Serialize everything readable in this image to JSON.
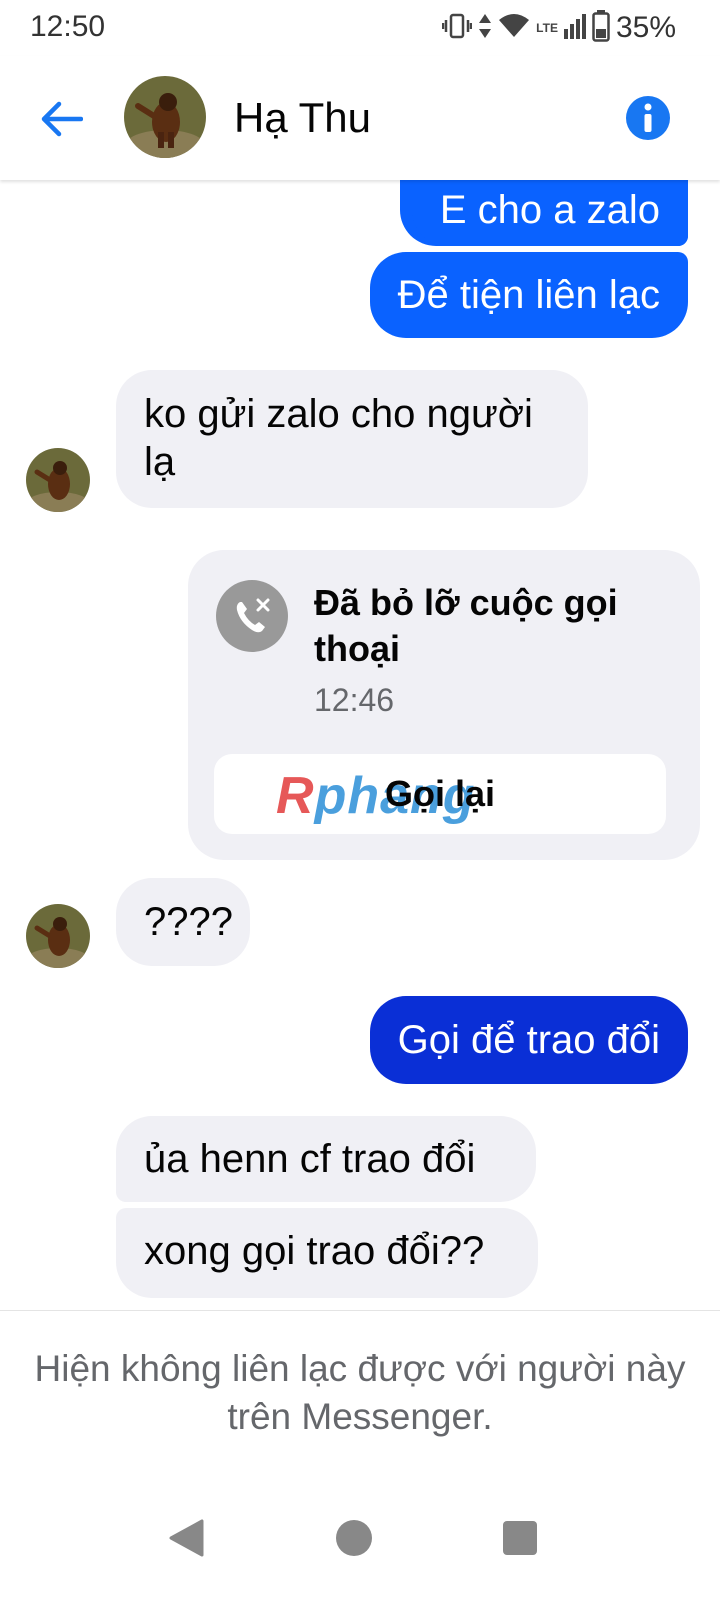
{
  "status_bar": {
    "time": "12:50",
    "network": "LTE",
    "battery": "35%"
  },
  "header": {
    "contact_name": "Hạ Thu",
    "back_icon": "back-arrow-icon",
    "info_icon": "info-icon",
    "accent_color": "#1877f2"
  },
  "messages": {
    "m1": "E cho a zalo",
    "m2": "Để tiện liên lạc",
    "m3_line1": "ko gửi zalo cho người",
    "m3_line2": "lạ",
    "call": {
      "title": "Đã bỏ lỡ cuộc gọi thoại",
      "time": "12:46",
      "button": "Gọi lại",
      "icon": "missed-call-icon"
    },
    "m4": "????",
    "m5": "Gọi để trao đổi",
    "m6": "ủa henn cf trao đổi",
    "m7": "xong gọi trao đổi??"
  },
  "watermark": {
    "part1": "R",
    "part2": "phang"
  },
  "notice": {
    "text": "Hiện không liên lạc được với người này trên Messenger."
  },
  "colors": {
    "outgoing_bubble": "#0a62ff",
    "outgoing_bubble_dark": "#0a2fd6",
    "incoming_bubble": "#f0f0f5"
  }
}
